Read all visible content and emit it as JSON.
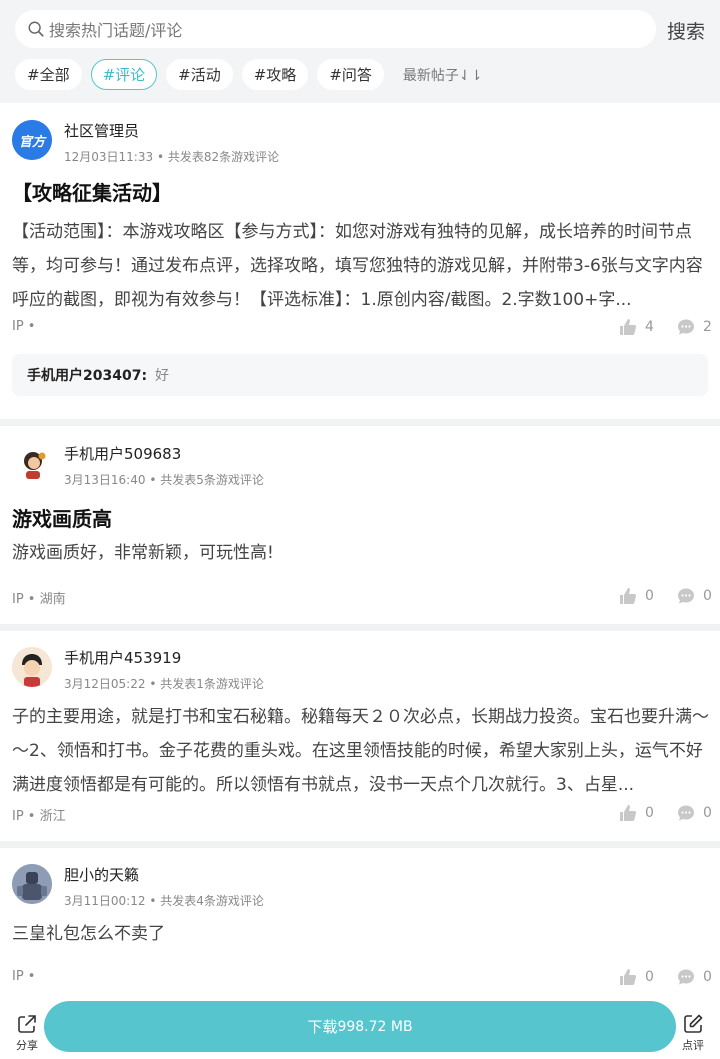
{
  "search": {
    "placeholder": "搜索热门话题/评论",
    "button_label": "搜索"
  },
  "tags": {
    "all": "#全部",
    "review": "#评论",
    "activity": "#活动",
    "guide": "#攻略",
    "qa": "#问答"
  },
  "sort": {
    "label": "最新帖子⇃⇂"
  },
  "posts": [
    {
      "username": "社区管理员",
      "avatar_text": "官方",
      "date": "12月03日11:33",
      "count_text": "共发表82条游戏评论",
      "title": "【攻略征集活动】",
      "body": "【活动范围】：本游戏攻略区【参与方式】：如您对游戏有独特的见解，成长培养的时间节点等，均可参与！通过发布点评，选择攻略，填写您独特的游戏见解，并附带3-6张与文字内容呼应的截图，即视为有效参与！【评选标准】：1.原创内容/截图。2.字数100+字...",
      "ip": "IP •",
      "likes": "4",
      "comments": "2",
      "reply_user": "手机用户203407:",
      "reply_text": "好"
    },
    {
      "username": "手机用户509683",
      "date": "3月13日16:40",
      "count_text": "共发表5条游戏评论",
      "title": "游戏画质高",
      "body": "游戏画质好，非常新颖，可玩性高!",
      "ip": "IP • 湖南",
      "likes": "0",
      "comments": "0"
    },
    {
      "username": "手机用户453919",
      "date": "3月12日05:22",
      "count_text": "共发表1条游戏评论",
      "body": "子的主要用途，就是打书和宝石秘籍。秘籍每天２０次必点，长期战力投资。宝石也要升满～～2、领悟和打书。金子花费的重头戏。在这里领悟技能的时候，希望大家别上头，运气不好满进度领悟都是有可能的。所以领悟有书就点，没书一天点个几次就行。3、占星...",
      "ip": "IP • 浙江",
      "likes": "0",
      "comments": "0"
    },
    {
      "username": "胆小的天籁",
      "date": "3月11日00:12",
      "count_text": "共发表4条游戏评论",
      "body": "三皇礼包怎么不卖了",
      "ip": "IP •",
      "likes": "0",
      "comments": "0"
    }
  ],
  "bottom": {
    "share_label": "分享",
    "download_label": "下载",
    "download_size": "998.72 MB",
    "review_label": "点评"
  },
  "colors": {
    "accent": "#56c5cd",
    "background": "#f3f4f6"
  },
  "icons": [
    "search-icon",
    "thumbs-up-icon",
    "comment-icon",
    "share-icon",
    "edit-icon"
  ]
}
